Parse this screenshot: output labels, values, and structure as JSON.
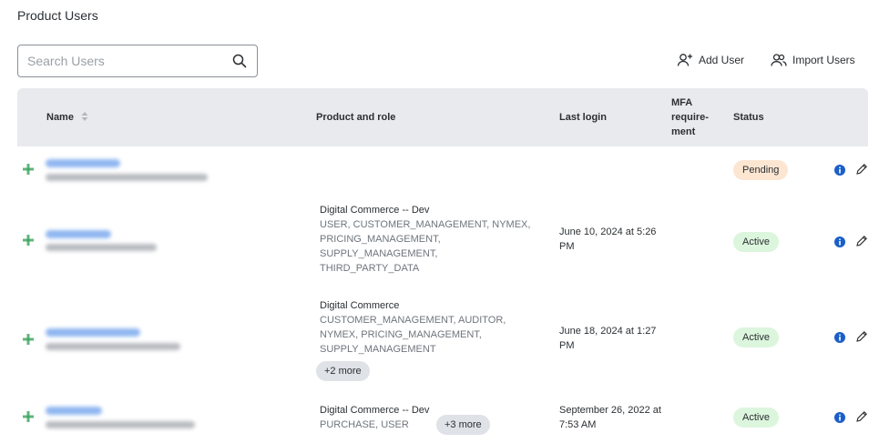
{
  "page": {
    "title": "Product Users"
  },
  "search": {
    "placeholder": "Search Users",
    "value": ""
  },
  "toolbar": {
    "add_user_label": "Add User",
    "import_users_label": "Import Users"
  },
  "table": {
    "columns": {
      "name": "Name",
      "product": "Product and role",
      "last_login": "Last login",
      "mfa": "MFA requirement",
      "mfa_display": [
        "MFA",
        "require-",
        "ment"
      ],
      "status": "Status"
    },
    "rows": [
      {
        "product_title": "",
        "product_roles": [],
        "more": "",
        "last_login": "",
        "status": "Pending",
        "status_kind": "pending"
      },
      {
        "product_title": "Digital Commerce -- Dev",
        "product_roles": [
          "USER, CUSTOMER_MANAGEMENT, NYMEX,",
          "PRICING_MANAGEMENT,",
          "SUPPLY_MANAGEMENT,",
          "THIRD_PARTY_DATA"
        ],
        "more": "",
        "last_login": "June 10, 2024 at 5:26 PM",
        "status": "Active",
        "status_kind": "active"
      },
      {
        "product_title": "Digital Commerce",
        "product_roles": [
          "CUSTOMER_MANAGEMENT, AUDITOR,",
          "NYMEX, PRICING_MANAGEMENT,",
          "SUPPLY_MANAGEMENT"
        ],
        "more": "+2 more",
        "last_login": "June 18, 2024 at 1:27 PM",
        "status": "Active",
        "status_kind": "active"
      },
      {
        "product_title": "Digital Commerce -- Dev",
        "product_roles": [
          "PURCHASE, USER"
        ],
        "more": "+3 more",
        "last_login": "September 26, 2022 at 7:53 AM",
        "status": "Active",
        "status_kind": "active"
      }
    ]
  },
  "colors": {
    "header_bg": "#e9eaed",
    "pending": "#fce6d2",
    "active": "#dcf6dd",
    "info": "#1a5fc8",
    "add_icon": "#3aa35b"
  }
}
